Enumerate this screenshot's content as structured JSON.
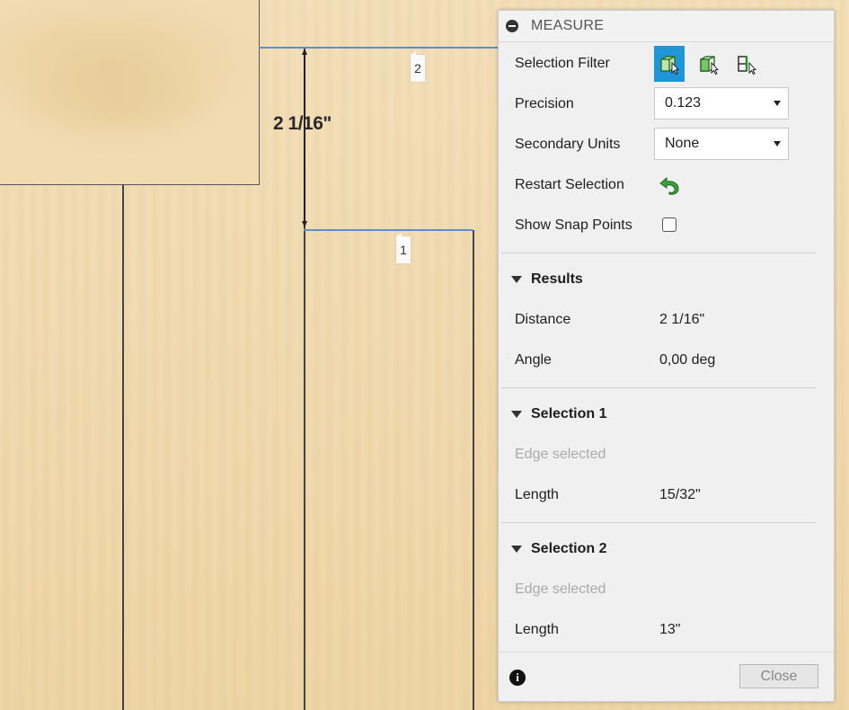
{
  "viewport": {
    "dimension_text": "2 1/16\"",
    "marker_1": "1",
    "marker_2": "2"
  },
  "panel": {
    "title": "MEASURE",
    "selection_filter": {
      "label": "Selection Filter",
      "icons": [
        "body-select-icon",
        "face-select-icon",
        "edge-select-icon"
      ],
      "active_index": 0
    },
    "precision": {
      "label": "Precision",
      "value": "0.123"
    },
    "secondary_units": {
      "label": "Secondary Units",
      "value": "None"
    },
    "restart_selection": {
      "label": "Restart Selection"
    },
    "show_snap_points": {
      "label": "Show Snap Points",
      "checked": false
    },
    "results": {
      "title": "Results",
      "distance_label": "Distance",
      "distance_value": "2 1/16\"",
      "angle_label": "Angle",
      "angle_value": "0,00 deg"
    },
    "selection1": {
      "title": "Selection 1",
      "status": "Edge selected",
      "length_label": "Length",
      "length_value": "15/32\""
    },
    "selection2": {
      "title": "Selection 2",
      "status": "Edge selected",
      "length_label": "Length",
      "length_value": "13\""
    },
    "footer": {
      "close_label": "Close",
      "info_icon": "i"
    }
  },
  "colors": {
    "accent": "#1f96d8",
    "selection_edge": "#5a8fd1",
    "restart_icon": "#3aa13a"
  }
}
